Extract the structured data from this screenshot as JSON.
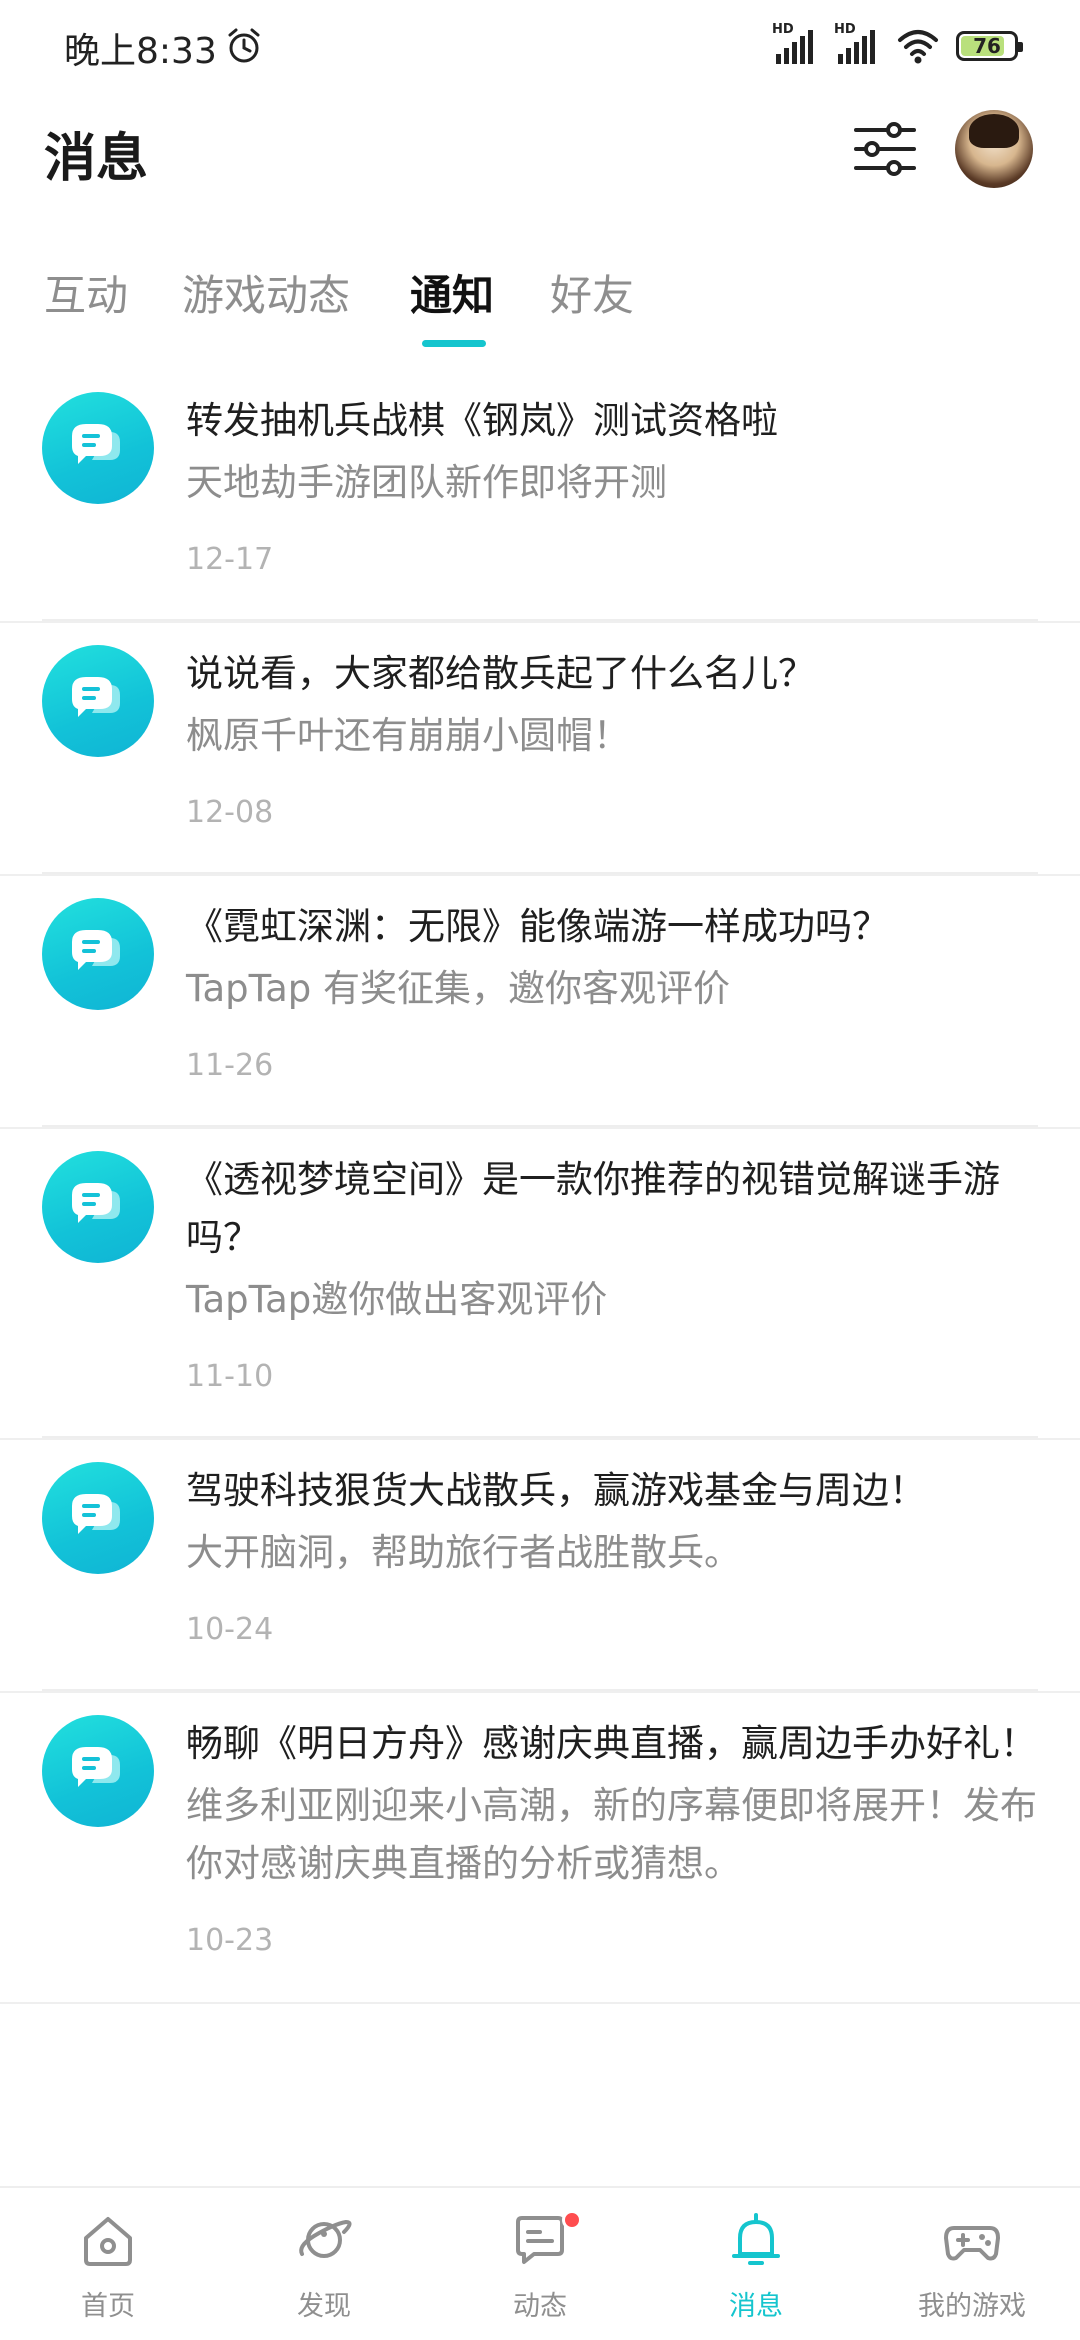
{
  "status_bar": {
    "time": "晚上8:33",
    "signal1_label": "HD",
    "signal2_label": "HD",
    "battery": "76"
  },
  "header": {
    "title": "消息"
  },
  "tabs": [
    {
      "label": "互动",
      "active": false
    },
    {
      "label": "游戏动态",
      "active": false
    },
    {
      "label": "通知",
      "active": true
    },
    {
      "label": "好友",
      "active": false
    }
  ],
  "notifications": [
    {
      "title": "转发抽机兵战棋《钢岚》测试资格啦",
      "subtitle": "天地劫手游团队新作即将开测",
      "date": "12-17"
    },
    {
      "title": "说说看，大家都给散兵起了什么名儿？",
      "subtitle": "枫原千叶还有崩崩小圆帽！",
      "date": "12-08"
    },
    {
      "title": "《霓虹深渊：无限》能像端游一样成功吗？",
      "subtitle": "TapTap 有奖征集，邀你客观评价",
      "date": "11-26"
    },
    {
      "title": "《透视梦境空间》是一款你推荐的视错觉解谜手游吗？",
      "subtitle": "TapTap邀你做出客观评价",
      "date": "11-10"
    },
    {
      "title": "驾驶科技狠货大战散兵，赢游戏基金与周边！",
      "subtitle": "大开脑洞，帮助旅行者战胜散兵。",
      "date": "10-24"
    },
    {
      "title": "畅聊《明日方舟》感谢庆典直播，赢周边手办好礼！",
      "subtitle": "维多利亚刚迎来小高潮，新的序幕便即将展开！发布你对感谢庆典直播的分析或猜想。",
      "date": "10-23"
    }
  ],
  "bottom_nav": [
    {
      "label": "首页",
      "icon": "home-icon",
      "active": false
    },
    {
      "label": "发现",
      "icon": "planet-icon",
      "active": false
    },
    {
      "label": "动态",
      "icon": "feed-icon",
      "active": false,
      "badge": true
    },
    {
      "label": "消息",
      "icon": "bell-icon",
      "active": true
    },
    {
      "label": "我的游戏",
      "icon": "gamepad-icon",
      "active": false
    }
  ],
  "colors": {
    "accent": "#15c5ce",
    "badge": "#ff4d4f",
    "muted_text": "#8d8d8d",
    "date_text": "#b3b3b3"
  }
}
